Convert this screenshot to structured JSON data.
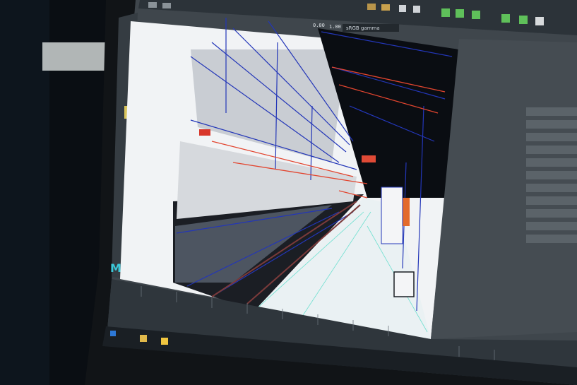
{
  "photo": {
    "subject": "monitor-showing-3d-software",
    "viewport_scene": "railway-station-platform-wireframe"
  },
  "toolbar": {
    "field_a": "0.00",
    "field_b": "1.00",
    "dropdown": "sRGB gamma"
  },
  "side_panel": {
    "items": [
      "",
      "",
      "",
      "",
      "",
      "",
      "",
      "",
      "",
      "",
      "",
      ""
    ]
  },
  "app_icon": "maya-m-icon",
  "colors": {
    "wire_blue": "#2336b8",
    "wire_red": "#e2452f",
    "wire_cyan": "#6fe0d0",
    "panel_grey": "#4a5258",
    "platform_white": "#e9ecef"
  }
}
